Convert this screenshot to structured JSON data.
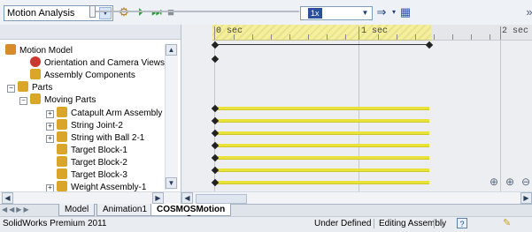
{
  "toolbar": {
    "study_type": "Motion Analysis",
    "speed": "1x",
    "icons": [
      "motion-study-properties-icon",
      "calculate-icon",
      "play-from-start-icon",
      "play-icon",
      "stop-icon",
      "dropdown-arrow-icon",
      "autokey-icon",
      "save-animation-icon"
    ]
  },
  "tree": {
    "items": [
      {
        "label": "Motion Model"
      },
      {
        "label": "Orientation and Camera Views"
      },
      {
        "label": "Assembly Components"
      },
      {
        "label": "Parts"
      },
      {
        "label": "Moving Parts"
      },
      {
        "label": "Catapult Arm Assembly Ne"
      },
      {
        "label": "String Joint-2"
      },
      {
        "label": "String with Ball 2-1"
      },
      {
        "label": "Target Block-1"
      },
      {
        "label": "Target Block-2"
      },
      {
        "label": "Target Block-3"
      },
      {
        "label": "Weight Assembly-1"
      }
    ]
  },
  "timeline": {
    "labels": [
      "0 sec",
      "1 sec",
      "2 sec"
    ]
  },
  "tabs": [
    {
      "label": "Model"
    },
    {
      "label": "Animation1"
    },
    {
      "label": "COSMOSMotion"
    }
  ],
  "status": {
    "product": "SolidWorks Premium 2011",
    "state": "Under Defined",
    "mode": "Editing Assembly"
  },
  "colors": {
    "timeline_band": "#f5ef9a",
    "bar": "#e8e23a"
  }
}
